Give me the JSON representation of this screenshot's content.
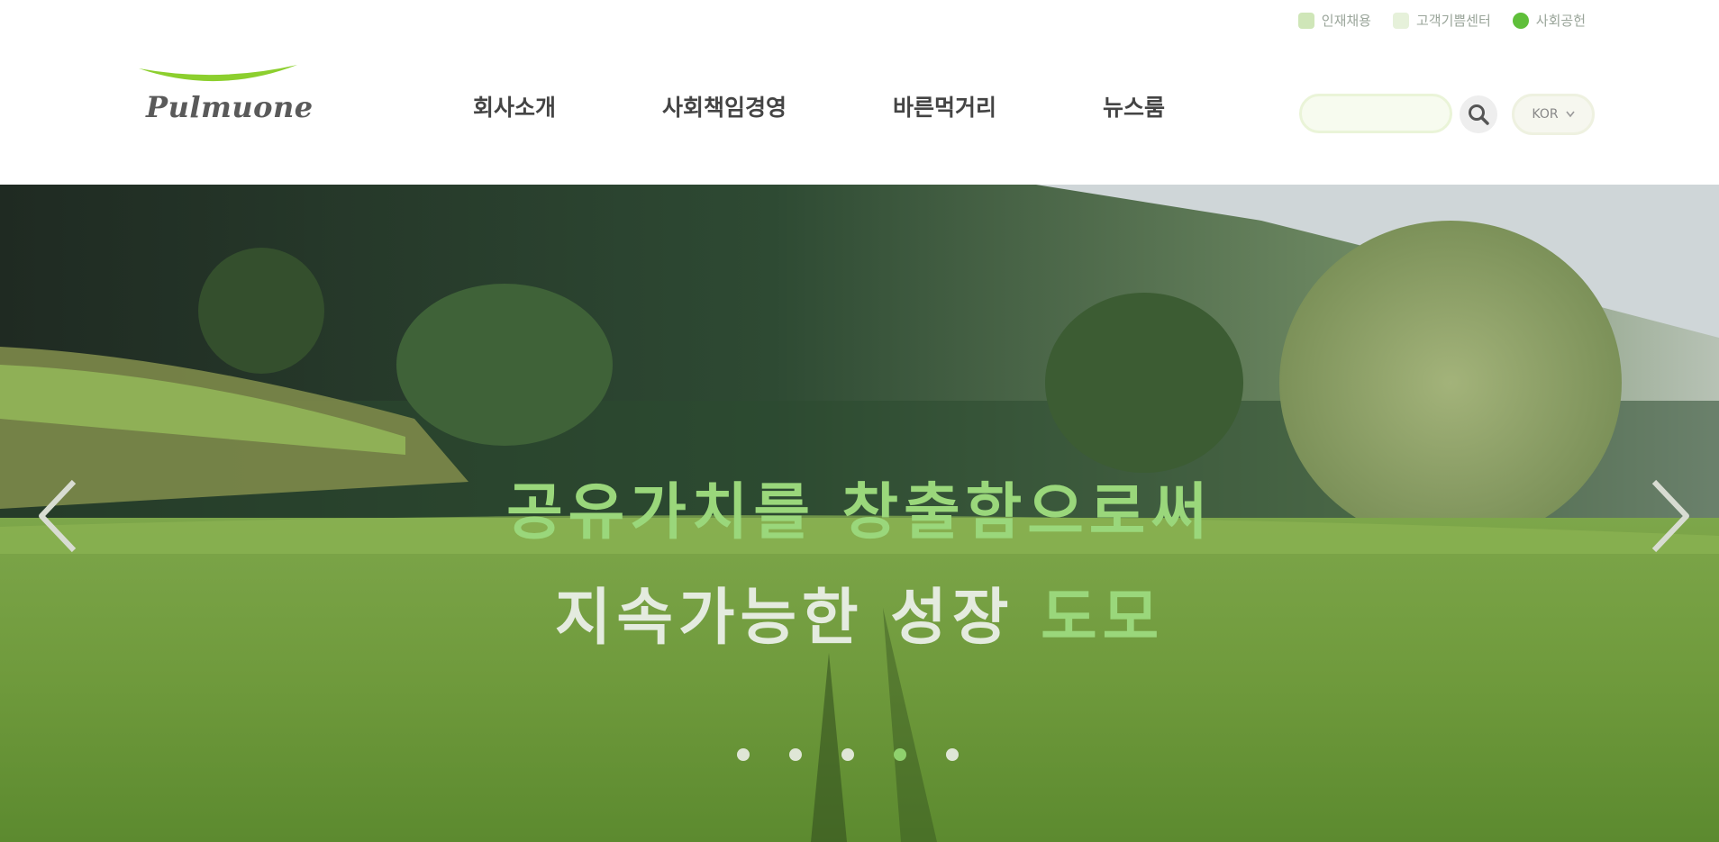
{
  "header": {
    "utility_links": [
      {
        "label": "인재채용",
        "state": "normal"
      },
      {
        "label": "고객기쁨센터",
        "state": "light"
      },
      {
        "label": "사회공헌",
        "state": "active"
      }
    ],
    "logo_text": "Pulmuone",
    "nav": [
      {
        "label": "회사소개"
      },
      {
        "label": "사회책임경영"
      },
      {
        "label": "바른먹거리"
      },
      {
        "label": "뉴스룸"
      }
    ],
    "search": {
      "placeholder": "",
      "value": ""
    },
    "language": {
      "selected": "KOR",
      "icon": "chevron-down-icon"
    }
  },
  "hero": {
    "headline_line1": "공유가치를 창출함으로써",
    "headline_line2_main": "지속가능한 성장",
    "headline_line2_accent": "도모",
    "prev_icon": "chevron-left-icon",
    "next_icon": "chevron-right-icon",
    "slides": 5,
    "active_slide": 4
  },
  "colors": {
    "brand_green": "#8ccf2e",
    "headline_green": "#9ad77b",
    "headline_white": "#e4ebdf",
    "nav_text": "#444444"
  }
}
